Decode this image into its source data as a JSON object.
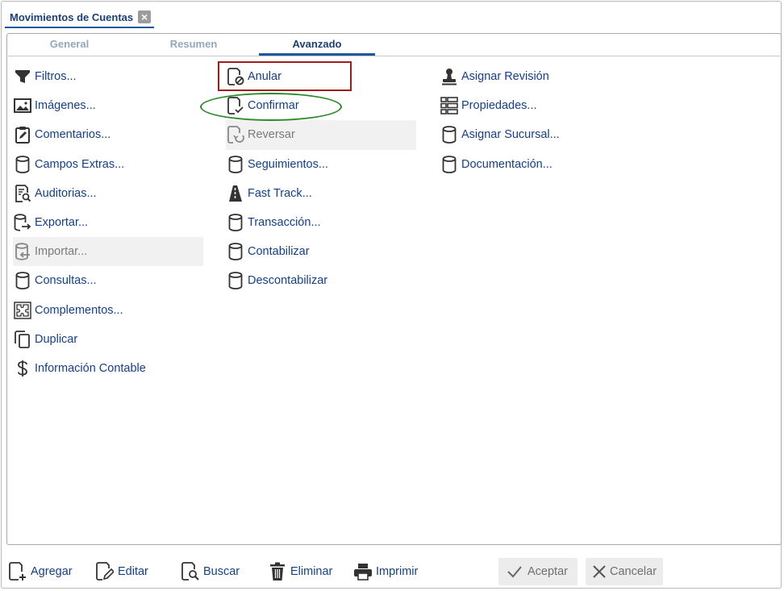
{
  "window": {
    "title": "Movimientos de Cuentas",
    "close_symbol": "×"
  },
  "tabs": [
    {
      "label": "General",
      "active": false
    },
    {
      "label": "Resumen",
      "active": false
    },
    {
      "label": "Avanzado",
      "active": true
    }
  ],
  "columns": [
    [
      {
        "label": "Filtros...",
        "icon": "funnel-icon",
        "enabled": true
      },
      {
        "label": "Imágenes...",
        "icon": "image-icon",
        "enabled": true
      },
      {
        "label": "Comentarios...",
        "icon": "clipboard-edit-icon",
        "enabled": true
      },
      {
        "label": "Campos Extras...",
        "icon": "database-icon",
        "enabled": true
      },
      {
        "label": "Auditorias...",
        "icon": "document-search-icon",
        "enabled": true
      },
      {
        "label": "Exportar...",
        "icon": "database-export-icon",
        "enabled": true
      },
      {
        "label": "Importar...",
        "icon": "database-import-icon",
        "enabled": false
      },
      {
        "label": "Consultas...",
        "icon": "database-icon",
        "enabled": true
      },
      {
        "label": "Complementos...",
        "icon": "puzzle-icon",
        "enabled": true
      },
      {
        "label": "Duplicar",
        "icon": "copy-icon",
        "enabled": true
      },
      {
        "label": "Información Contable",
        "icon": "dollar-icon",
        "enabled": true
      }
    ],
    [
      {
        "label": "Anular",
        "icon": "document-cancel-icon",
        "enabled": true
      },
      {
        "label": "Confirmar",
        "icon": "document-check-icon",
        "enabled": true
      },
      {
        "label": "Reversar",
        "icon": "document-undo-icon",
        "enabled": false
      },
      {
        "label": "Seguimientos...",
        "icon": "database-icon",
        "enabled": true
      },
      {
        "label": "Fast Track...",
        "icon": "fast-track-icon",
        "enabled": true
      },
      {
        "label": "Transacción...",
        "icon": "database-icon",
        "enabled": true
      },
      {
        "label": "Contabilizar",
        "icon": "database-icon",
        "enabled": true
      },
      {
        "label": "Descontabilizar",
        "icon": "database-icon",
        "enabled": true
      }
    ],
    [
      {
        "label": "Asignar Revisión",
        "icon": "stamp-icon",
        "enabled": true
      },
      {
        "label": "Propiedades...",
        "icon": "properties-grid-icon",
        "enabled": true
      },
      {
        "label": "Asignar Sucursal...",
        "icon": "database-icon",
        "enabled": true
      },
      {
        "label": "Documentación...",
        "icon": "database-icon",
        "enabled": true
      }
    ]
  ],
  "footer": {
    "agregar": "Agregar",
    "editar": "Editar",
    "buscar": "Buscar",
    "eliminar": "Eliminar",
    "imprimir": "Imprimir",
    "aceptar": "Aceptar",
    "cancelar": "Cancelar"
  },
  "colors": {
    "link": "#143f8c",
    "accent": "#1c57a0",
    "highlight_red": "#a01d1d",
    "highlight_green": "#2a8a2a"
  }
}
